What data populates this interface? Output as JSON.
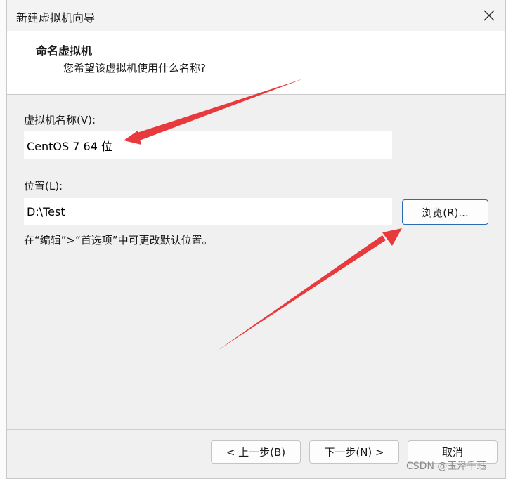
{
  "window": {
    "title": "新建虚拟机向导"
  },
  "header": {
    "title": "命名虚拟机",
    "subtitle": "您希望该虚拟机使用什么名称?"
  },
  "form": {
    "vm_name_label": "虚拟机名称(V):",
    "vm_name_value": "CentOS 7 64 位",
    "location_label": "位置(L):",
    "location_value": "D:\\Test",
    "browse_label": "浏览(R)...",
    "hint": "在“编辑”>“首选项”中可更改默认位置。"
  },
  "footer": {
    "back_label": "< 上一步(B)",
    "next_label": "下一步(N) >",
    "cancel_label": "取消"
  },
  "watermark": "CSDN @玉泽千珏",
  "colors": {
    "annotation_arrow": "#e8393c",
    "focus_border": "#2b6cb0"
  }
}
